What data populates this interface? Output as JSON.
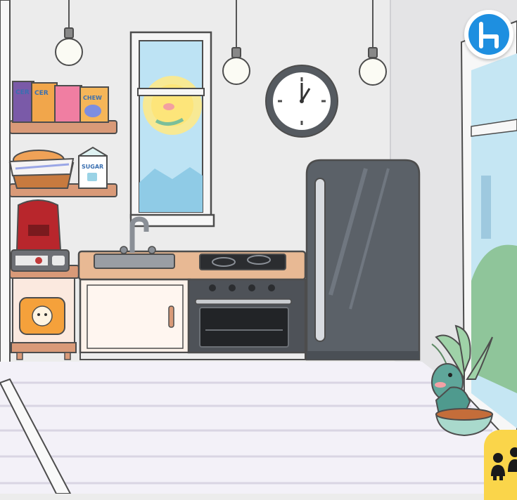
{
  "scene": {
    "name": "kitchen-room",
    "colors": {
      "wall": "#ececec",
      "wall_shadow": "#dcdcde",
      "floor": "#f3f1f8",
      "floor_line": "#d9d5e3",
      "counter_top": "#e8b994",
      "cabinet": "#fdf2ea",
      "fridge": "#5b6168",
      "shelf": "#d99a78",
      "window_sky": "#bde3f4",
      "accent_blue": "#1e8fe0",
      "accent_yellow": "#fad54a"
    }
  },
  "shelf_items": {
    "cereal_box_label_1": "CER",
    "cereal_box_label_2": "CER",
    "cereal_box_label_3": "CHEW",
    "milk_carton_label": "SUGAR"
  },
  "clock": {
    "time_display": "1:00"
  },
  "buttons": {
    "furniture_icon": "chair-icon",
    "characters_icon": "people-icon"
  }
}
